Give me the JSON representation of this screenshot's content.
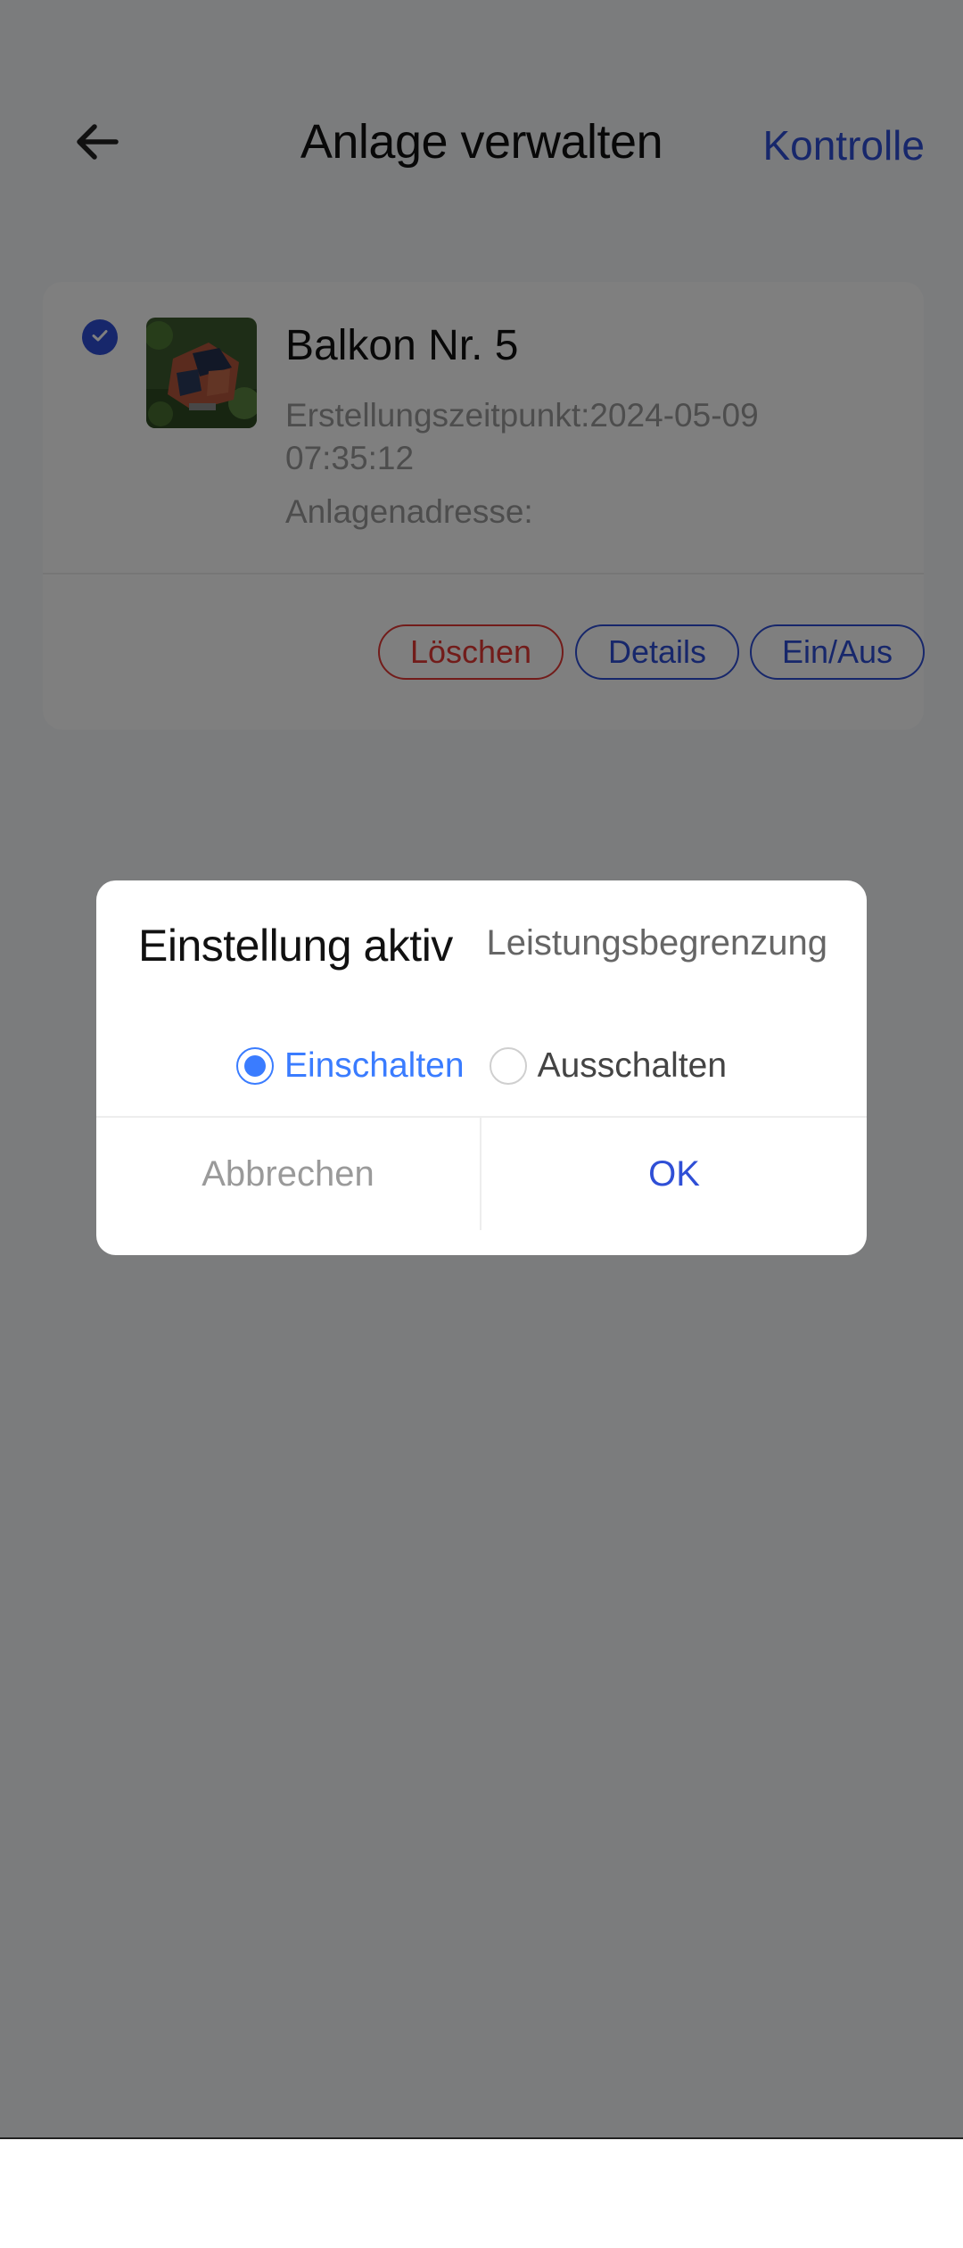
{
  "header": {
    "title": "Anlage verwalten",
    "right_link": "Kontrolle"
  },
  "plant": {
    "selected": true,
    "name": "Balkon Nr. 5",
    "created_label": "Erstellungszeitpunkt:2024-05-09 07:35:12",
    "address_label": "Anlagenadresse:",
    "actions": {
      "delete": "Löschen",
      "details": "Details",
      "onoff": "Ein/Aus"
    }
  },
  "dialog": {
    "title": "Einstellung aktiv",
    "subtitle": "Leistungsbegrenzung",
    "options": [
      {
        "label": "Einschalten",
        "selected": true
      },
      {
        "label": "Ausschalten",
        "selected": false
      }
    ],
    "cancel": "Abbrechen",
    "ok": "OK"
  },
  "colors": {
    "accent": "#2f4fd6",
    "radio_active": "#3a7cff",
    "danger": "#e53935"
  }
}
